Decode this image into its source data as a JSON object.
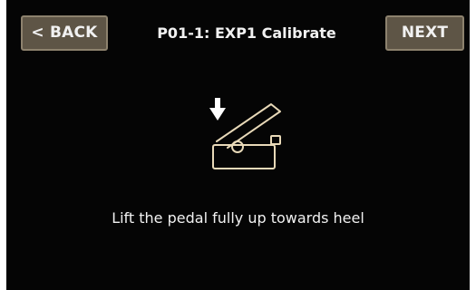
{
  "header": {
    "back_label": "< BACK",
    "title": "P01-1: EXP1 Calibrate",
    "next_label": "NEXT"
  },
  "main": {
    "icon": "expression-pedal-heel-down-icon",
    "instruction": "Lift the pedal fully up towards heel"
  },
  "colors": {
    "background": "#050505",
    "button_fill": "#5e5546",
    "button_border": "#8d826e",
    "text": "#f1f1f1",
    "pedal_glow": "#e8d9b8"
  }
}
